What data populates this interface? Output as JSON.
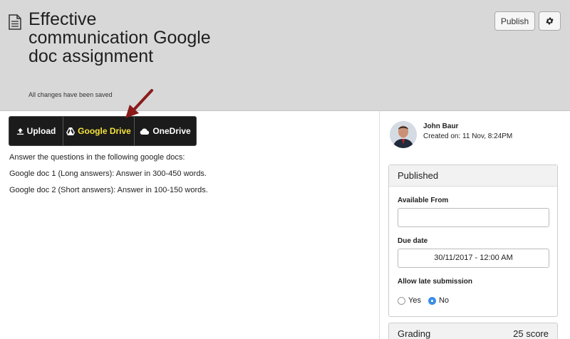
{
  "header": {
    "title": "Effective communication Google doc assignment",
    "saved_status": "All changes have been saved",
    "publish_label": "Publish"
  },
  "upload_bar": {
    "upload_label": "Upload",
    "google_drive_label": "Google Drive",
    "onedrive_label": "OneDrive",
    "highlight_color": "#f5e33a"
  },
  "content": {
    "intro": "Answer the questions in the following google docs:",
    "line1": "Google doc 1 (Long answers): Answer in 300-450 words.",
    "line2": "Google doc 2 (Short answers): Answer in 100-150 words."
  },
  "author": {
    "name": "John Baur",
    "created": "Created on: 11 Nov, 8:24PM"
  },
  "publish_panel": {
    "heading": "Published",
    "available_from_label": "Available From",
    "available_from_value": "",
    "due_date_label": "Due date",
    "due_date_value": "30/11/2017 - 12:00 AM",
    "late_label": "Allow late submission",
    "options": [
      "Yes",
      "No"
    ],
    "selected": "No"
  },
  "grading": {
    "label": "Grading",
    "score": "25 score"
  },
  "annotation_arrow_color": "#8b1a1a"
}
